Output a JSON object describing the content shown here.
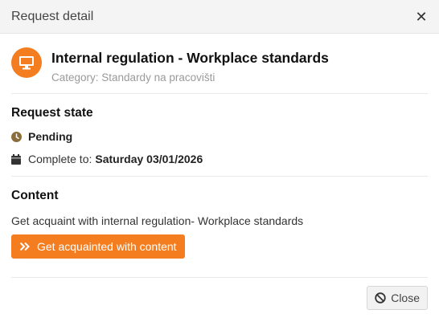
{
  "header": {
    "title": "Request detail",
    "close_icon": "close-icon"
  },
  "request": {
    "icon": "monitor-icon",
    "title": "Internal regulation - Workplace standards",
    "category": "Category: Standardy na pracovišti"
  },
  "state_section": {
    "title": "Request state",
    "status": "Pending",
    "status_icon": "clock-icon",
    "complete_label": "Complete to:",
    "complete_date": "Saturday 03/01/2026",
    "date_icon": "calendar-icon"
  },
  "content_section": {
    "title": "Content",
    "text": "Get acquaint with internal regulation- Workplace standards",
    "button_label": "Get acquainted with content",
    "button_icon": "double-chevron-right-icon"
  },
  "footer": {
    "close_label": "Close",
    "close_icon": "ban-icon"
  },
  "colors": {
    "accent": "#f47d20",
    "pending": "#8a6d3b"
  }
}
